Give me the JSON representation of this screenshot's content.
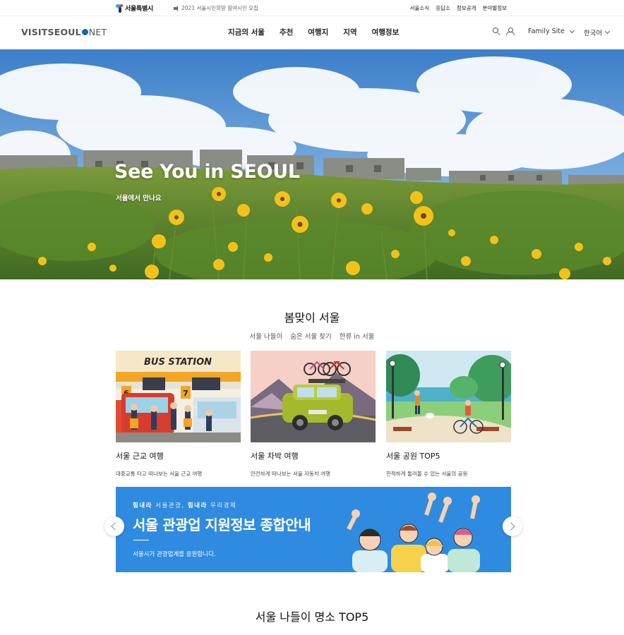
{
  "topbar": {
    "logo_text": "서울특별시",
    "notice": "2021 서울시민희망 참여시민 모집",
    "links": [
      "서울소식",
      "응답소",
      "정보공개",
      "분야별정보"
    ]
  },
  "header": {
    "brand_main": "VISITSEOUL",
    "brand_tail": "NET",
    "nav": [
      "지금의 서울",
      "추천",
      "여행지",
      "지역",
      "여행정보"
    ],
    "family_site": "Family Site",
    "language": "한국어"
  },
  "hero": {
    "title": "See You in SEOUL",
    "subtitle": "서울에서 만나요"
  },
  "section": {
    "title": "봄맞이 서울",
    "tabs": [
      "서울 나들이",
      "숨은 서울 찾기",
      "한류 in 서울"
    ],
    "cards": [
      {
        "title": "서울 근교 여행",
        "desc": "대중교통 타고 떠나보는 서울 근교 여행",
        "sign": "BUS STATION"
      },
      {
        "title": "서울 차박 여행",
        "desc": "안전하게 떠나보는 서울 자동차 여행"
      },
      {
        "title": "서울 공원 TOP5",
        "desc": "한적하게 둘러볼 수 있는 서울의 공원"
      }
    ]
  },
  "banner": {
    "kicker_bold1": "힘내라",
    "kicker_mid": " 서울관광, ",
    "kicker_bold2": "힘내라",
    "kicker_end": " 우리경제",
    "title": "서울 관광업 지원정보 종합안내",
    "desc": "서울시가 관광업계를 응원합니다."
  },
  "section2": {
    "title": "서울 나들이 명소 TOP5"
  },
  "colors": {
    "brand_dot": "#0f6ab4",
    "banner_bg": "#2f8be0"
  }
}
